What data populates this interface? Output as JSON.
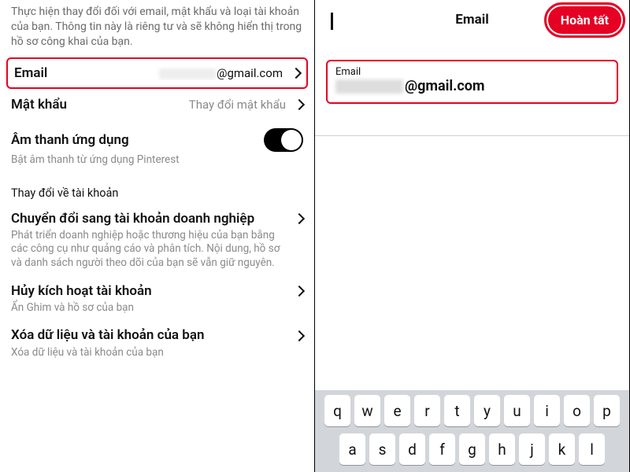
{
  "left": {
    "intro": "Thực hiện thay đổi đối với email, mật khẩu và loại tài khoản của bạn. Thông tin này là riêng tư và sẽ không hiển thị trong hồ sơ công khai của bạn.",
    "email_row": {
      "label": "Email",
      "domain": "@gmail.com"
    },
    "password_row": {
      "label": "Mật khẩu",
      "action": "Thay đổi mật khẩu"
    },
    "sound": {
      "label": "Âm thanh ứng dụng",
      "sub": "Bật âm thanh từ ứng dụng Pinterest"
    },
    "section": "Thay đổi về tài khoản",
    "biz": {
      "title": "Chuyển đổi sang tài khoản doanh nghiệp",
      "desc": "Phát triển doanh nghiệp hoặc thương hiệu của bạn bằng các công cụ như quảng cáo và phân tích. Nội dung, hồ sơ và danh sách người theo dõi của bạn sẽ vẫn giữ nguyên."
    },
    "deactivate": {
      "title": "Hủy kích hoạt tài khoản",
      "desc": "Ẩn Ghim và hồ sơ của bạn"
    },
    "delete": {
      "title": "Xóa dữ liệu và tài khoản của bạn",
      "desc": "Xóa dữ liệu và tài khoản của bạn"
    }
  },
  "right": {
    "nav_title": "Email",
    "done": "Hoàn tất",
    "field_label": "Email",
    "field_domain": "@gmail.com"
  },
  "keyboard": {
    "row1": [
      "q",
      "w",
      "e",
      "r",
      "t",
      "y",
      "u",
      "i",
      "o",
      "p"
    ],
    "row2": [
      "a",
      "s",
      "d",
      "f",
      "g",
      "h",
      "j",
      "k",
      "l"
    ]
  }
}
